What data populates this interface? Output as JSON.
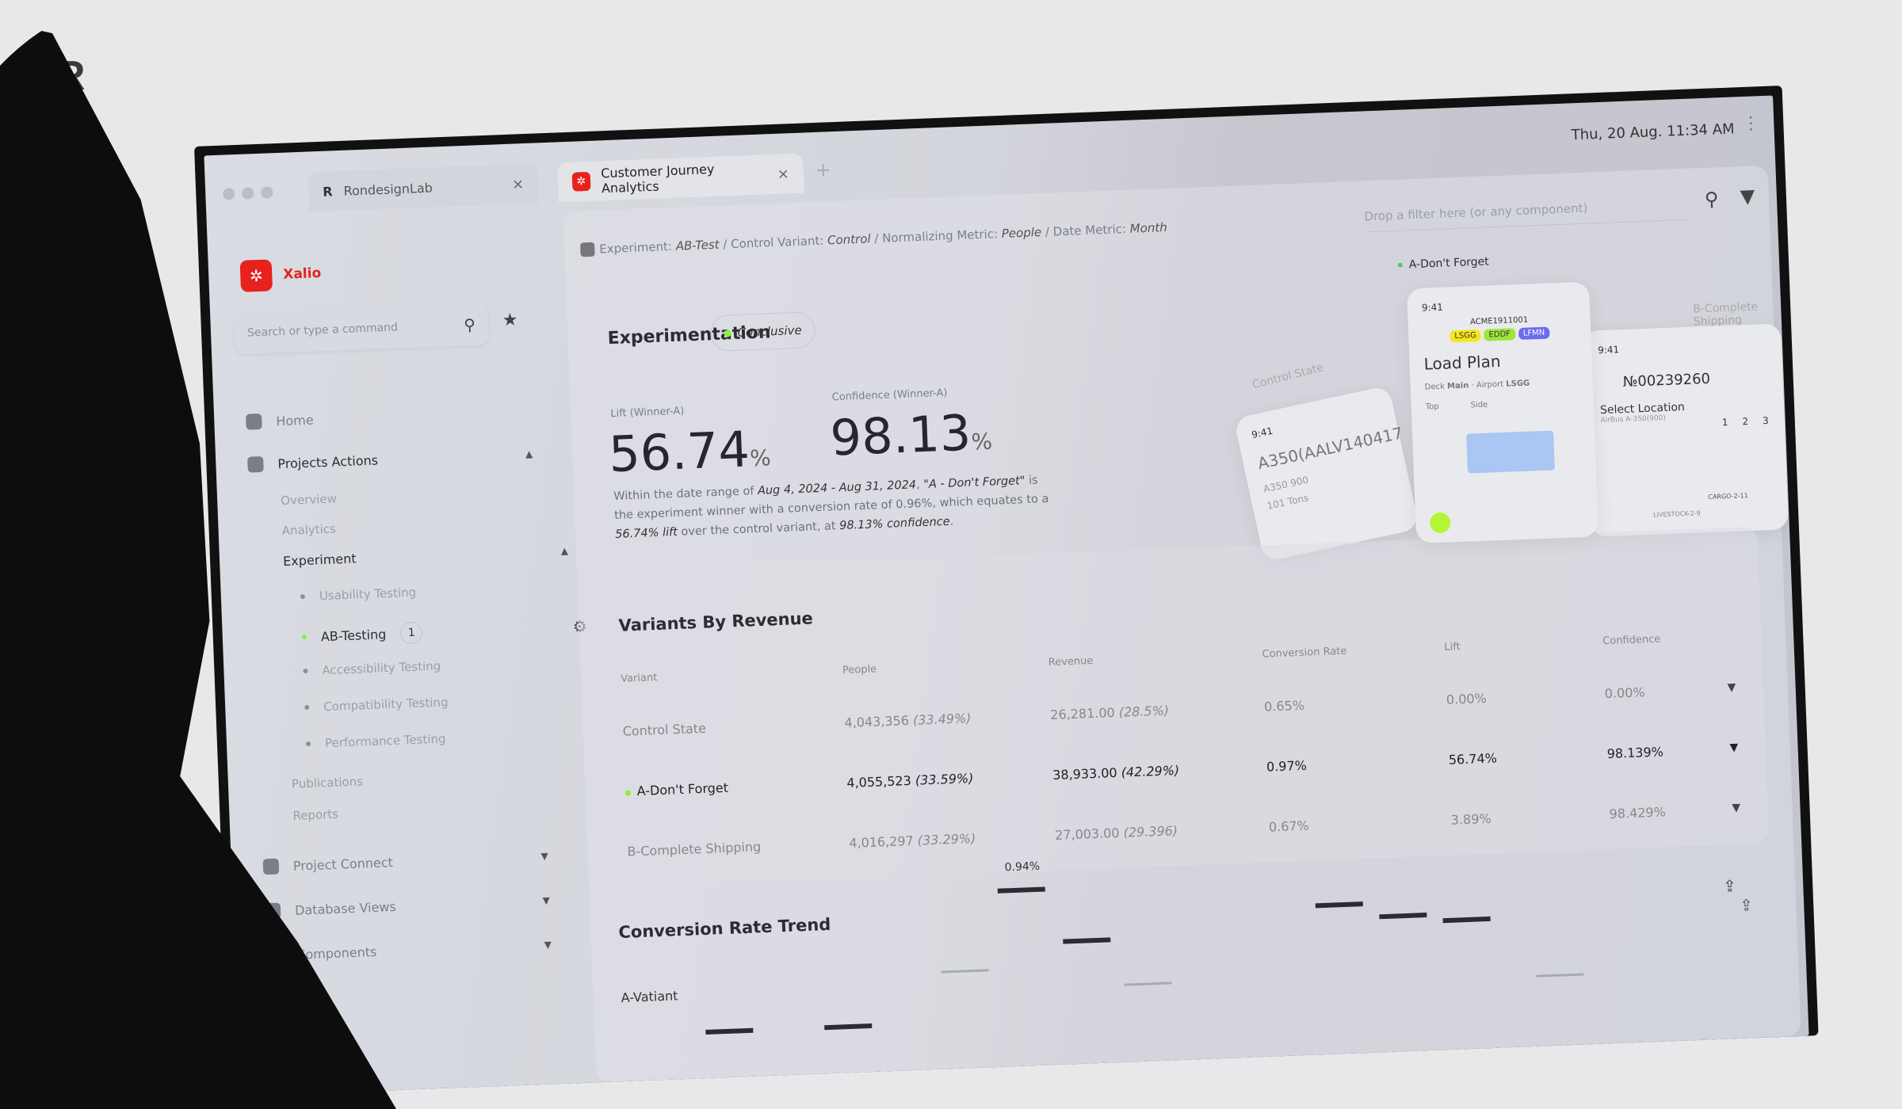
{
  "brand_mark": "R",
  "browser": {
    "tabs": [
      {
        "label": "RondesignLab",
        "close": "×"
      },
      {
        "label": "Customer Journey Analytics",
        "close": "×",
        "active": true
      }
    ],
    "new_tab": "+",
    "datetime": "Thu, 20 Aug. 11:34 AM"
  },
  "sidebar": {
    "app_name": "Xalio",
    "search_placeholder": "Search or type a command",
    "items": [
      {
        "label": "Home",
        "icon": "grid-icon"
      },
      {
        "label": "Projects Actions",
        "icon": "folder-icon",
        "expanded": true
      },
      {
        "label": "Overview"
      },
      {
        "label": "Analytics"
      },
      {
        "label": "Experiment",
        "expanded": true
      },
      {
        "label": "Usability Testing"
      },
      {
        "label": "AB-Testing",
        "badge": "1",
        "active": true
      },
      {
        "label": "Accessibility Testing"
      },
      {
        "label": "Compatibility Testing"
      },
      {
        "label": "Performance Testing"
      },
      {
        "label": "Publications"
      },
      {
        "label": "Reports"
      },
      {
        "label": "Project Connect",
        "icon": "compass-icon"
      },
      {
        "label": "Database Views",
        "icon": "file-upload-icon"
      },
      {
        "label": "Components",
        "icon": "components-icon"
      }
    ]
  },
  "breadcrumb": {
    "p1": "Experiment: ",
    "v1": "AB-Test",
    "p2": " / Control Variant: ",
    "v2": "Control",
    "p3": " / Normalizing Metric: ",
    "v3": "People",
    "p4": " / Date Metric: ",
    "v4": "Month"
  },
  "filter_placeholder": "Drop a filter here (or any component)",
  "experiment": {
    "title": "Experimentation",
    "status": "Conclusive",
    "status_color": "#8bf13a",
    "lift_label": "Lift (Winner-A)",
    "lift_value": "56.74",
    "confidence_label": "Confidence (Winner-A)",
    "confidence_value": "98.13",
    "unit": "%",
    "summary": {
      "t1": "Within the date range of ",
      "d": "Aug 4, 2024 - Aug 31, 2024",
      "t2": ", ",
      "w": "\"A - Don't Forget\"",
      "t3": " is the experiment winner with a conversion rate of 0.96%, which equates to a ",
      "l": "56.74% lift",
      "t4": " over the control variant, at ",
      "c": "98.13% confidence",
      "t5": "."
    }
  },
  "previews": {
    "winner_label": "A-Don't Forget",
    "control_label": "Control State",
    "b_label": "B-Complete Shipping",
    "phone_time": "9:41",
    "control_title": "A350(AALV140417",
    "control_l1": "A350 900",
    "control_l2": "101 Tons",
    "mid_code": "ACME1911001",
    "mid_chips": [
      "LSGG",
      "EDDF",
      "LFMN"
    ],
    "mid_title": "Load Plan",
    "mid_deck": "Deck",
    "mid_deck_val": "Main",
    "mid_airport": "Airport",
    "mid_airport_val": "LSGG",
    "mid_top": "Top",
    "mid_side": "Side",
    "b_title": "№00239260",
    "b_sub": "Select Location",
    "b_sub2": "AirBus A-350(900)",
    "b_steps": [
      "1",
      "2",
      "3"
    ],
    "b_cargo": "CARGO-2-11",
    "b_live": "LIVESTOCK-2-9"
  },
  "variants": {
    "title": "Variants By Revenue",
    "columns": [
      "Variant",
      "People",
      "Revenue",
      "Conversion Rate",
      "Lift",
      "Confidence"
    ],
    "rows": [
      [
        "Control State",
        "4,043,356",
        "(33.49%)",
        "26,281.00",
        "(28.5%)",
        "0.65%",
        "0.00%",
        "0.00%"
      ],
      [
        "A-Don't Forget",
        "4,055,523",
        "(33.59%)",
        "38,933.00",
        "(42.29%)",
        "0.97%",
        "56.74%",
        "98.139%"
      ],
      [
        "B-Complete Shipping",
        "4,016,297",
        "(33.29%)",
        "27,003.00",
        "(29.396)",
        "0.67%",
        "3.89%",
        "98.429%"
      ]
    ]
  },
  "trend": {
    "title": "Conversion Rate Trend",
    "series_label": "A-Vatiant",
    "peak_label": "0.94%",
    "values": [
      0.55,
      0.55,
      0.7,
      0.94,
      0.78,
      0.64,
      0.86,
      0.82,
      0.8,
      0.62
    ],
    "muted": [
      false,
      false,
      true,
      false,
      false,
      true,
      false,
      false,
      false,
      true
    ]
  }
}
